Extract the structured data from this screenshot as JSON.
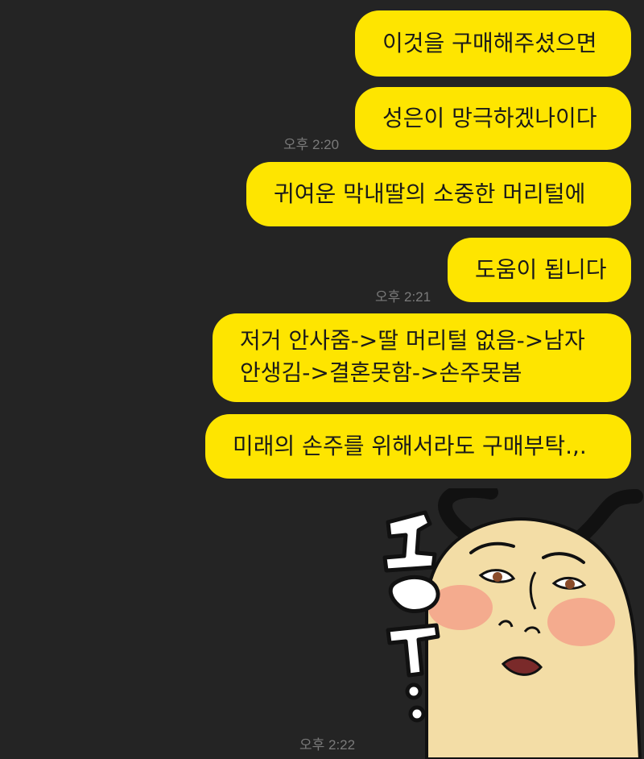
{
  "messages": [
    {
      "text": "이것을 구매해주셨으면"
    },
    {
      "text": "성은이 망극하겠나이다",
      "time": "오후 2:20"
    },
    {
      "text": "귀여운 막내딸의 소중한 머리털에"
    },
    {
      "text": "도움이 됩니다",
      "time": "오후 2:21"
    },
    {
      "lines": [
        "저거 안사줌->딸 머리털 없음->남자",
        "안생김->결혼못함->손주못봄"
      ]
    },
    {
      "text": "미래의 손주를 위해서라도 구매부탁.,."
    }
  ],
  "sticker": {
    "icon": "face-sticker-icon",
    "text": "그윽..",
    "time": "오후 2:22"
  },
  "colors": {
    "background": "#242424",
    "bubble": "#FEE500",
    "time": "#7a7a7a"
  }
}
